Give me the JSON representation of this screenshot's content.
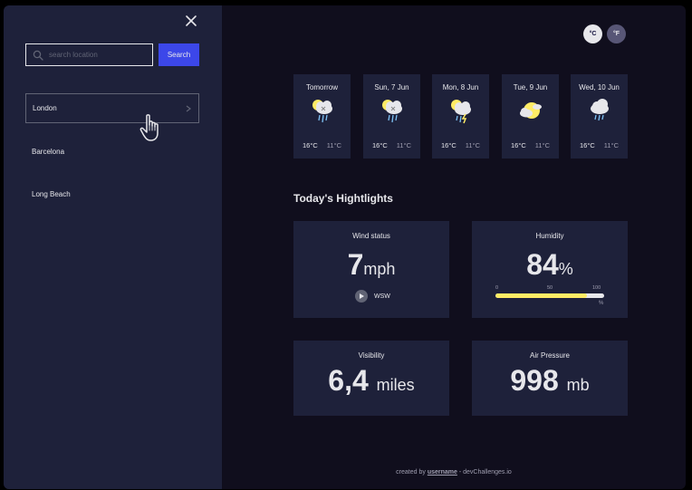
{
  "search": {
    "placeholder": "search location",
    "button_label": "Search",
    "locations": [
      "London",
      "Barcelona",
      "Long Beach"
    ]
  },
  "units": {
    "celsius": "°C",
    "fahrenheit": "°F",
    "selected": "°C"
  },
  "forecast": [
    {
      "day": "Tomorrow",
      "max": "16°C",
      "min": "11°C",
      "icon": "sleet-icon"
    },
    {
      "day": "Sun, 7 Jun",
      "max": "16°C",
      "min": "11°C",
      "icon": "sleet-icon"
    },
    {
      "day": "Mon, 8 Jun",
      "max": "16°C",
      "min": "11°C",
      "icon": "thunderstorm-icon"
    },
    {
      "day": "Tue, 9 Jun",
      "max": "16°C",
      "min": "11°C",
      "icon": "partly-cloudy-icon"
    },
    {
      "day": "Wed, 10 Jun",
      "max": "16°C",
      "min": "11°C",
      "icon": "rain-icon"
    }
  ],
  "highlights": {
    "title": "Today's Hightlights",
    "wind": {
      "label": "Wind status",
      "value": "7",
      "unit": "mph",
      "direction": "WSW"
    },
    "humidity": {
      "label": "Humidity",
      "value": "84",
      "unit": "%",
      "scale": [
        "0",
        "50",
        "100"
      ],
      "scale_unit": "%",
      "fraction": 0.84
    },
    "visibility": {
      "label": "Visibility",
      "value": "6,4",
      "unit": "miles"
    },
    "pressure": {
      "label": "Air Pressure",
      "value": "998",
      "unit": "mb"
    }
  },
  "footer": {
    "prefix": "created by",
    "username": "username",
    "suffix": "- devChallenges.io"
  },
  "colors": {
    "panel": "#1e213a",
    "background": "#100e1d",
    "accent": "#3c47e9",
    "bar": "#ffec65"
  }
}
